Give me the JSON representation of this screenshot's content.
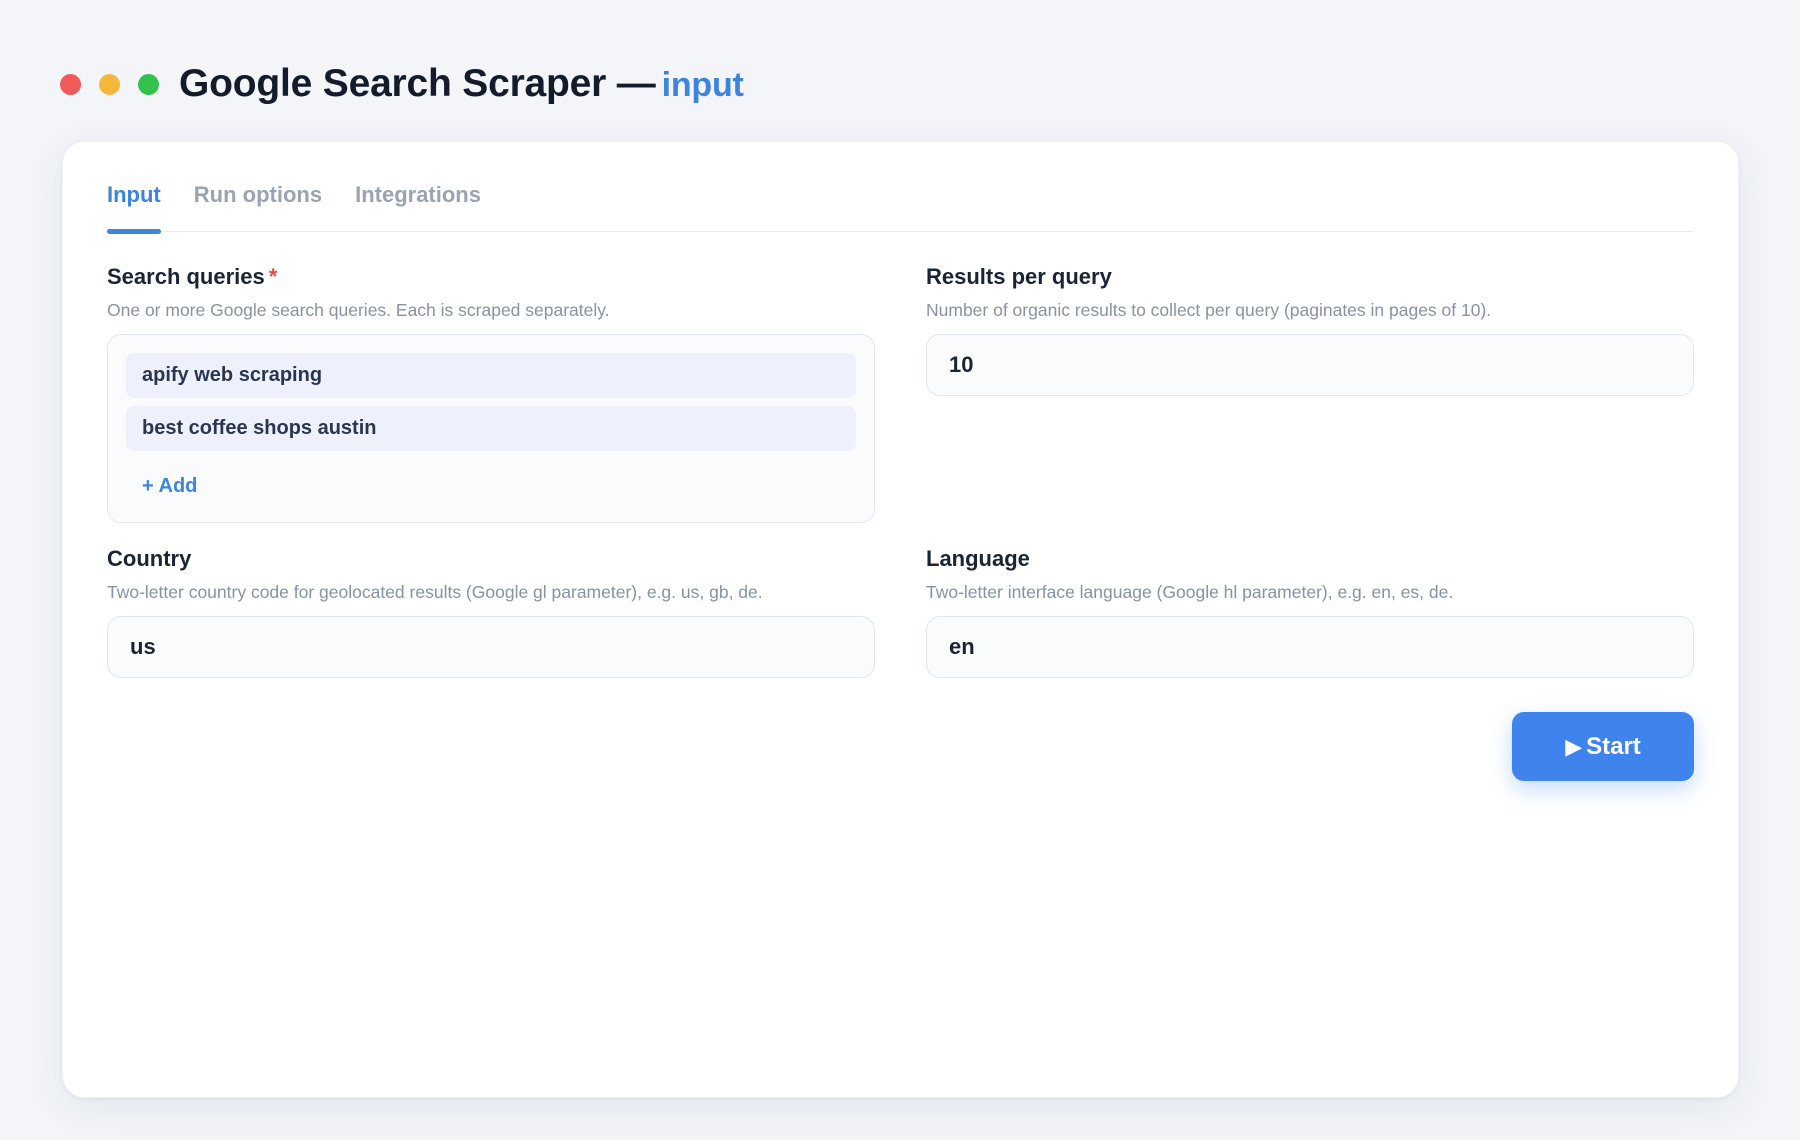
{
  "window": {
    "title": "Google Search Scraper —",
    "title_accent": "input",
    "controls": [
      "close",
      "minimize",
      "maximize"
    ]
  },
  "tabs": [
    {
      "label": "Input",
      "active": true
    },
    {
      "label": "Run options",
      "active": false
    },
    {
      "label": "Integrations",
      "active": false
    }
  ],
  "fields": {
    "search_queries": {
      "label": "Search queries",
      "required_mark": "*",
      "help": "One or more Google search queries. Each is scraped separately.",
      "items": [
        "apify web scraping",
        "best coffee shops austin"
      ],
      "add_label": "+ Add"
    },
    "results_per_query": {
      "label": "Results per query",
      "help": "Number of organic results to collect per query (paginates in pages of 10).",
      "value": "10"
    },
    "country": {
      "label": "Country",
      "help": "Two-letter country code for geolocated results (Google gl parameter), e.g. us, gb, de.",
      "value": "us"
    },
    "language": {
      "label": "Language",
      "help": "Two-letter interface language (Google hl parameter), e.g. en, es, de.",
      "value": "en"
    }
  },
  "actions": {
    "start_icon": "▶",
    "start_label": "Start"
  },
  "colors": {
    "accent": "#3d84de",
    "button": "#3f83ec",
    "required": "#ec4a4a",
    "close": "#f05a5a",
    "minimize": "#f6b73a",
    "maximize": "#30c24a"
  }
}
